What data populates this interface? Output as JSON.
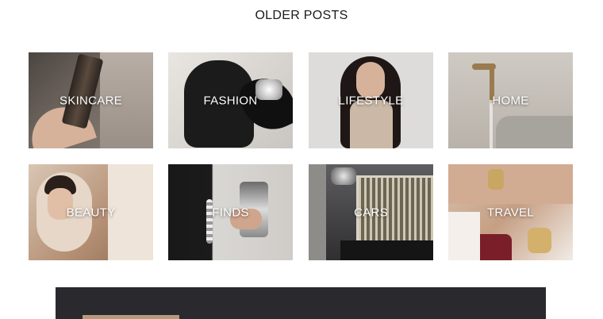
{
  "section": {
    "title": "OLDER POSTS"
  },
  "categories": [
    {
      "label": "SKINCARE",
      "image": "skincare-bottle-in-hand"
    },
    {
      "label": "FASHION",
      "image": "handbag-and-jeweled-heel"
    },
    {
      "label": "LIFESTYLE",
      "image": "woman-long-dark-hair"
    },
    {
      "label": "HOME",
      "image": "brass-tub-faucet"
    },
    {
      "label": "BEAUTY",
      "image": "man-looking-in-mirror"
    },
    {
      "label": "FINDS",
      "image": "phone-case-in-hand"
    },
    {
      "label": "CARS",
      "image": "luxury-car-grille"
    },
    {
      "label": "TRAVEL",
      "image": "gold-watch-and-bracelets"
    }
  ],
  "colors": {
    "band": "#2a2a2e",
    "tan": "#b69a7c"
  }
}
